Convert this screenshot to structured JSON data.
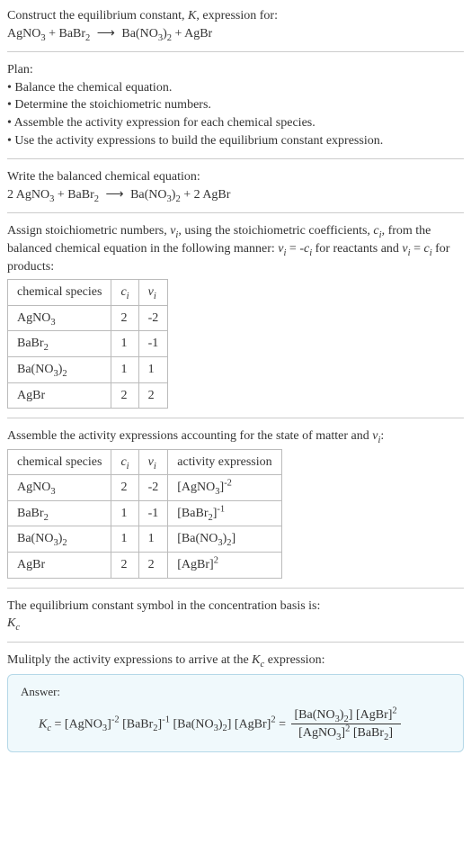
{
  "intro": {
    "line1": "Construct the equilibrium constant, ",
    "Ksym": "K",
    "line1b": ", expression for:",
    "eq_lhs1": "AgNO",
    "eq_lhs2": " + BaBr",
    "eq_arrow": "⟶",
    "eq_rhs1": "Ba(NO",
    "eq_rhs2": ")",
    "eq_rhs3": " + AgBr"
  },
  "plan": {
    "header": "Plan:",
    "b1": "• Balance the chemical equation.",
    "b2": "• Determine the stoichiometric numbers.",
    "b3": "• Assemble the activity expression for each chemical species.",
    "b4": "• Use the activity expressions to build the equilibrium constant expression."
  },
  "balanced": {
    "header": "Write the balanced chemical equation:",
    "c1": "2 AgNO",
    "c2": " + BaBr",
    "c3": "Ba(NO",
    "c4": ")",
    "c5": " + 2 AgBr"
  },
  "assign": {
    "text1": "Assign stoichiometric numbers, ",
    "nu": "ν",
    "text2": ", using the stoichiometric coefficients, ",
    "csym": "c",
    "text3": ", from the balanced chemical equation in the following manner: ",
    "rel1a": "ν",
    "rel1b": " = -",
    "rel1c": "c",
    "text4": " for reactants and ",
    "rel2a": "ν",
    "rel2b": " = ",
    "rel2c": "c",
    "text5": " for products:"
  },
  "table1": {
    "h1": "chemical species",
    "h2": "c",
    "h3": "ν",
    "rows": [
      {
        "sp": "AgNO",
        "spSub": "3",
        "c": "2",
        "v": "-2"
      },
      {
        "sp": "BaBr",
        "spSub": "2",
        "c": "1",
        "v": "-1"
      },
      {
        "sp": "Ba(NO",
        "spSub": "3",
        "spAfter": ")",
        "spSub2": "2",
        "c": "1",
        "v": "1"
      },
      {
        "sp": "AgBr",
        "spSub": "",
        "c": "2",
        "v": "2"
      }
    ]
  },
  "assemble": {
    "text1": "Assemble the activity expressions accounting for the state of matter and ",
    "nu": "ν",
    "text2": ":"
  },
  "table2": {
    "h1": "chemical species",
    "h2": "c",
    "h3": "ν",
    "h4": "activity expression",
    "rows": [
      {
        "sp": "AgNO",
        "spSub": "3",
        "c": "2",
        "v": "-2",
        "act1": "[AgNO",
        "act2": "]",
        "exp": "-2"
      },
      {
        "sp": "BaBr",
        "spSub": "2",
        "c": "1",
        "v": "-1",
        "act1": "[BaBr",
        "act2": "]",
        "exp": "-1"
      },
      {
        "sp": "Ba(NO",
        "spSub": "3",
        "spAfter": ")",
        "spSub2": "2",
        "c": "1",
        "v": "1",
        "act1": "[Ba(NO",
        "act2": ")",
        "act3": "]",
        "exp": ""
      },
      {
        "sp": "AgBr",
        "spSub": "",
        "c": "2",
        "v": "2",
        "act1": "[AgBr]",
        "act2": "",
        "exp": "2"
      }
    ]
  },
  "ksym": {
    "text": "The equilibrium constant symbol in the concentration basis is:",
    "K": "K",
    "c": "c"
  },
  "mult": {
    "text1": "Mulitply the activity expressions to arrive at the ",
    "K": "K",
    "c": "c",
    "text2": " expression:"
  },
  "answer": {
    "label": "Answer:",
    "K": "K",
    "c": "c",
    "eq": " = [AgNO",
    "t1": "]",
    "e1": "-2",
    "t2": " [BaBr",
    "e2": "-1",
    "t3": " [Ba(NO",
    "t4": ")",
    "t5": "] [AgBr]",
    "e3": "2",
    "eqmid": " = ",
    "num1": "[Ba(NO",
    "num2": ")",
    "num3": "] [AgBr]",
    "den1": "[AgNO",
    "den2": "]",
    "den3": " [BaBr",
    "den4": "]"
  },
  "subs": {
    "i": "i",
    "3": "3",
    "2": "2"
  }
}
